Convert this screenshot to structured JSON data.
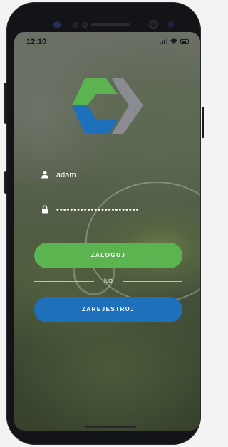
{
  "status_bar": {
    "time": "12:10",
    "icons": [
      "signal-icon",
      "wifi-icon",
      "battery-icon"
    ]
  },
  "logo": {
    "icon": "cube-logo-icon",
    "colors": {
      "green": "#5bb44f",
      "blue": "#1f70bb",
      "gray": "#8a8c92"
    }
  },
  "login_form": {
    "username": {
      "icon": "user-icon",
      "value": "adam"
    },
    "password": {
      "icon": "lock-icon",
      "value": "••••••••••••••••••••••••"
    },
    "login_button": {
      "label": "ZALOGUJ",
      "color": "#5bb44f"
    },
    "separator_text": "lub",
    "register_button": {
      "label": "ZAREJESTRUJ",
      "color": "#1f70bb"
    }
  }
}
